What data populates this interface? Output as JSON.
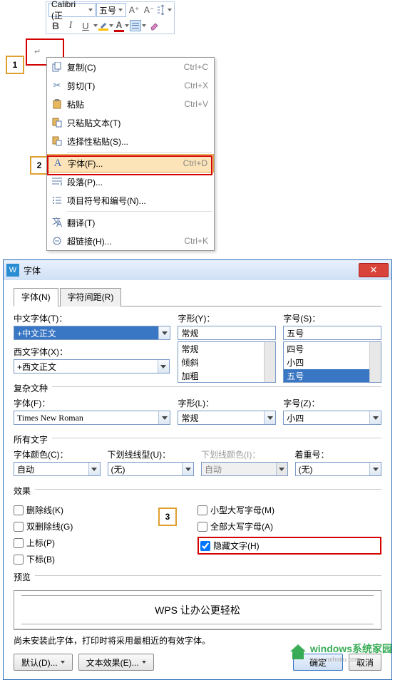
{
  "toolbar": {
    "font_name": "Calibri (正",
    "font_size": "五号",
    "aplus": "A⁺",
    "aminus": "A⁻"
  },
  "context_menu": {
    "items": [
      {
        "icon": "copy",
        "label": "复制(C)",
        "shortcut": "Ctrl+C"
      },
      {
        "icon": "cut",
        "label": "剪切(T)",
        "shortcut": "Ctrl+X"
      },
      {
        "icon": "paste",
        "label": "粘贴",
        "shortcut": "Ctrl+V"
      },
      {
        "icon": "paste-text",
        "label": "只粘贴文本(T)",
        "shortcut": ""
      },
      {
        "icon": "paste-special",
        "label": "选择性粘贴(S)...",
        "shortcut": ""
      },
      {
        "icon": "font",
        "label": "字体(F)...",
        "shortcut": "Ctrl+D",
        "hl": true
      },
      {
        "icon": "paragraph",
        "label": "段落(P)...",
        "shortcut": ""
      },
      {
        "icon": "bullets",
        "label": "项目符号和编号(N)...",
        "shortcut": ""
      },
      {
        "icon": "translate",
        "label": "翻译(T)",
        "shortcut": ""
      },
      {
        "icon": "link",
        "label": "超链接(H)...",
        "shortcut": "Ctrl+K"
      }
    ]
  },
  "dialog": {
    "title": "字体",
    "tabs": [
      "字体(N)",
      "字符间距(R)"
    ],
    "cn_font_label": "中文字体(T)：",
    "cn_font_value": "+中文正文",
    "style_label": "字形(Y)：",
    "style_value": "常规",
    "style_list": [
      "常规",
      "倾斜",
      "加粗"
    ],
    "size_label": "字号(S)：",
    "size_value": "五号",
    "size_list": [
      "四号",
      "小四",
      "五号"
    ],
    "en_font_label": "西文字体(X)：",
    "en_font_value": "+西文正文",
    "complex_title": "复杂文种",
    "cfont_label": "字体(F)：",
    "cfont_value": "Times New Roman",
    "cstyle_label": "字形(L)：",
    "cstyle_value": "常规",
    "csize_label": "字号(Z)：",
    "csize_value": "小四",
    "all_text_title": "所有文字",
    "color_label": "字体颜色(C)：",
    "color_value": "自动",
    "under_label": "下划线线型(U)：",
    "under_value": "(无)",
    "under_color_label": "下划线颜色(I)：",
    "under_color_value": "自动",
    "emph_label": "着重号：",
    "emph_value": "(无)",
    "effects_title": "效果",
    "chk": {
      "strike": "删除线(K)",
      "dstrike": "双删除线(G)",
      "super": "上标(P)",
      "sub": "下标(B)",
      "smallcaps": "小型大写字母(M)",
      "allcaps": "全部大写字母(A)",
      "hidden": "隐藏文字(H)"
    },
    "preview_title": "预览",
    "preview_text": "WPS 让办公更轻松",
    "note": "尚未安装此字体，打印时将采用最相近的有效字体。",
    "btn_default": "默认(D)...",
    "btn_effect": "文本效果(E)...",
    "btn_ok": "确定",
    "btn_cancel": "取消"
  },
  "callouts": {
    "c1": "1",
    "c2": "2",
    "c3": "3"
  },
  "watermark": {
    "text": "windows系统家园",
    "sub": "www.ruihaitu.com"
  }
}
